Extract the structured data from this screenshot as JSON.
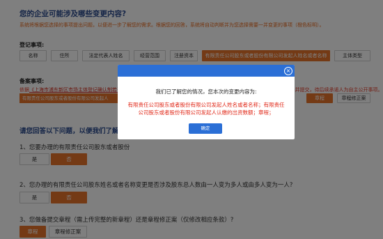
{
  "section1": {
    "question": "您的企业可能涉及哪些变更内容?",
    "hint": "系统将根据您选择的事项提出问题，以便进一步了解您的需求。根据您的回答，系统将自动判断并为您选择需要一并变更的事项（橙色标明）。"
  },
  "registration": {
    "label": "登记事项:",
    "tags": [
      "名称",
      "住所",
      "法定代表人姓名",
      "经营范围",
      "注册资本",
      "有限责任公司股东或者股份有限公司发起人姓名或者名称",
      "主体类型"
    ]
  },
  "filing": {
    "label": "备案事项:",
    "note_prefix": "依据",
    "note_link": "《上海市浦东新区市场主体登记确认制若干规定》",
    "note_suffix": "，如您需要办理章程备案或章程修正案备案的，办理变更时需将相关事项一并提交，待后续承诺人为自主公开事项。",
    "strip_text": "有限责任公司股东或者股份有限公司发起人",
    "tags": [
      "章程",
      "章程修正案"
    ]
  },
  "section2": {
    "question": "请您回答以下问题，以便我们了解您",
    "q1": "1、您要办理的有限责任公司股东或者股份",
    "q2": "2、您办理的有限责任公司股东姓名或者名称变更是否涉及股东总人数由一人变为多人或由多人变为一人?",
    "q3": "3、您做备提交章程（需上传完整的新章程）还是章程修正案（仅修改相应条款）?",
    "yes": "是",
    "no": "否",
    "charter": "章程",
    "amendment": "章程修正案"
  },
  "dialog": {
    "close_symbol": "×",
    "message": "我们已了解您的情况，您本次的变更内容为:",
    "body": "有限责任公司股东或者股份有限公司发起人姓名或者名称；有限责任公司股东或者股份有限公司发起人认缴的出资数额；章程；",
    "confirm": "确定"
  },
  "colors": {
    "accent": "#e8742a",
    "dialog_blue": "#2b6fd6",
    "title_blue": "#2a4a8f",
    "warning_red": "#e12a1a"
  }
}
